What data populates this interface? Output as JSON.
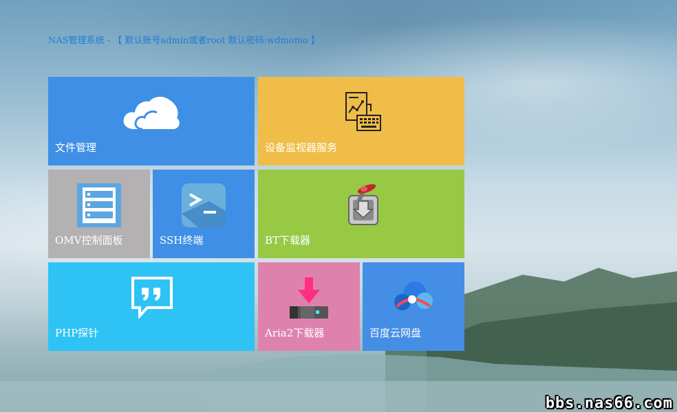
{
  "header": {
    "title": "NAS管理系统 - 【 默认账号admin或者root 默认密码:wdmomo 】"
  },
  "tiles": [
    {
      "label": "文件管理",
      "icon": "cloud-icon",
      "color": "#3f8fe6"
    },
    {
      "label": "设备监视器服务",
      "icon": "monitor-chart-icon",
      "color": "#f0bd48"
    },
    {
      "label": "OMV控制面板",
      "icon": "server-icon",
      "color": "#b3b1b1"
    },
    {
      "label": "SSH终端",
      "icon": "terminal-icon",
      "color": "#3f8fe6"
    },
    {
      "label": "BT下载器",
      "icon": "transmission-icon",
      "color": "#97c945"
    },
    {
      "label": "PHP探针",
      "icon": "quote-bubble-icon",
      "color": "#2fc3f5"
    },
    {
      "label": "Aria2下载器",
      "icon": "download-drive-icon",
      "color": "#de82ad"
    },
    {
      "label": "百度云网盘",
      "icon": "baidu-cloud-icon",
      "color": "#458ee6"
    }
  ],
  "watermark": "bbs.nas66.com"
}
